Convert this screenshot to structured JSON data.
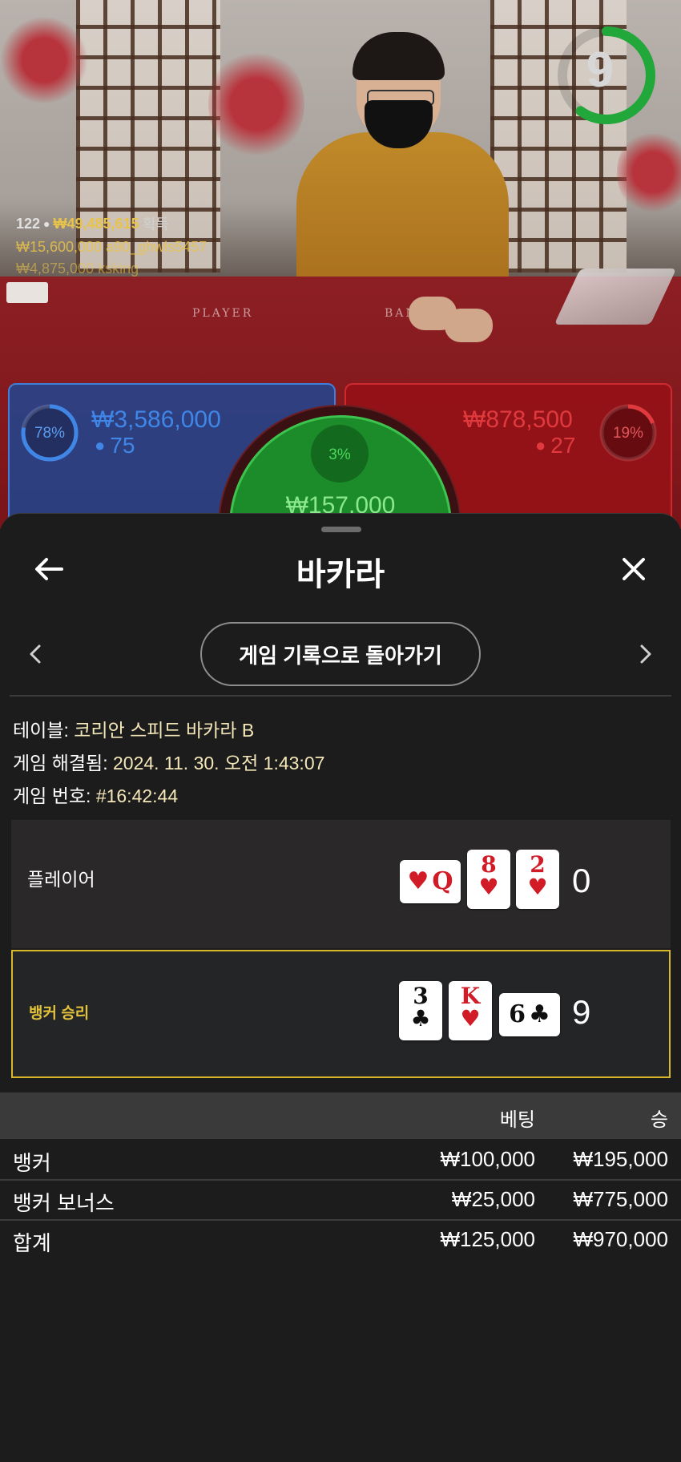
{
  "video": {
    "countdown": "9",
    "table_labels": {
      "player": "PLAYER",
      "banker": "BANKER"
    },
    "winners": {
      "count": "122",
      "total": "₩49,485,615",
      "suffix": "획득",
      "list": [
        "₩15,600,000  a90_ghwls5457",
        "₩4,875,000  ksking"
      ]
    },
    "bets": {
      "player": {
        "percent": 78,
        "percent_label": "78%",
        "amount": "₩3,586,000",
        "players": "75",
        "color": "#3f86e6"
      },
      "banker": {
        "percent": 19,
        "percent_label": "19%",
        "amount": "₩878,500",
        "players": "27",
        "color": "#e03a3f"
      },
      "tie": {
        "percent": 3,
        "percent_label": "3%",
        "amount": "₩157,000",
        "color": "#46d45a"
      }
    }
  },
  "sheet": {
    "back_icon": "arrow-left-icon",
    "title": "바카라",
    "close_icon": "close-icon",
    "prev_icon": "chevron-left-icon",
    "next_icon": "chevron-right-icon",
    "back_to_history": "게임 기록으로 돌아가기",
    "info": {
      "table_label": "테이블:",
      "table_value": "코리안 스피드 바카라 B",
      "resolved_label": "게임 해결됨:",
      "resolved_value": "2024. 11. 30. 오전 1:43:07",
      "number_label": "게임 번호:",
      "number_value": "#16:42:44"
    },
    "hands": {
      "player": {
        "label": "플레이어",
        "score": "0",
        "cards": [
          {
            "rank": "Q",
            "suit": "♥",
            "color": "red",
            "orientation": "side"
          },
          {
            "rank": "8",
            "suit": "♥",
            "color": "red",
            "orientation": "up"
          },
          {
            "rank": "2",
            "suit": "♥",
            "color": "red",
            "orientation": "up"
          }
        ]
      },
      "banker": {
        "label": "뱅커 승리",
        "score": "9",
        "cards": [
          {
            "rank": "3",
            "suit": "♣",
            "color": "black",
            "orientation": "up"
          },
          {
            "rank": "K",
            "suit": "♥",
            "color": "red",
            "orientation": "up"
          },
          {
            "rank": "6",
            "suit": "♣",
            "color": "black",
            "orientation": "side"
          }
        ]
      }
    },
    "bets_table": {
      "headers": {
        "bet": "베팅",
        "win": "승"
      },
      "rows": [
        {
          "name": "뱅커",
          "bet": "₩100,000",
          "win": "₩195,000"
        },
        {
          "name": "뱅커 보너스",
          "bet": "₩25,000",
          "win": "₩775,000"
        },
        {
          "name": "합계",
          "bet": "₩125,000",
          "win": "₩970,000"
        }
      ]
    },
    "accent_color": "#d8b82b"
  }
}
